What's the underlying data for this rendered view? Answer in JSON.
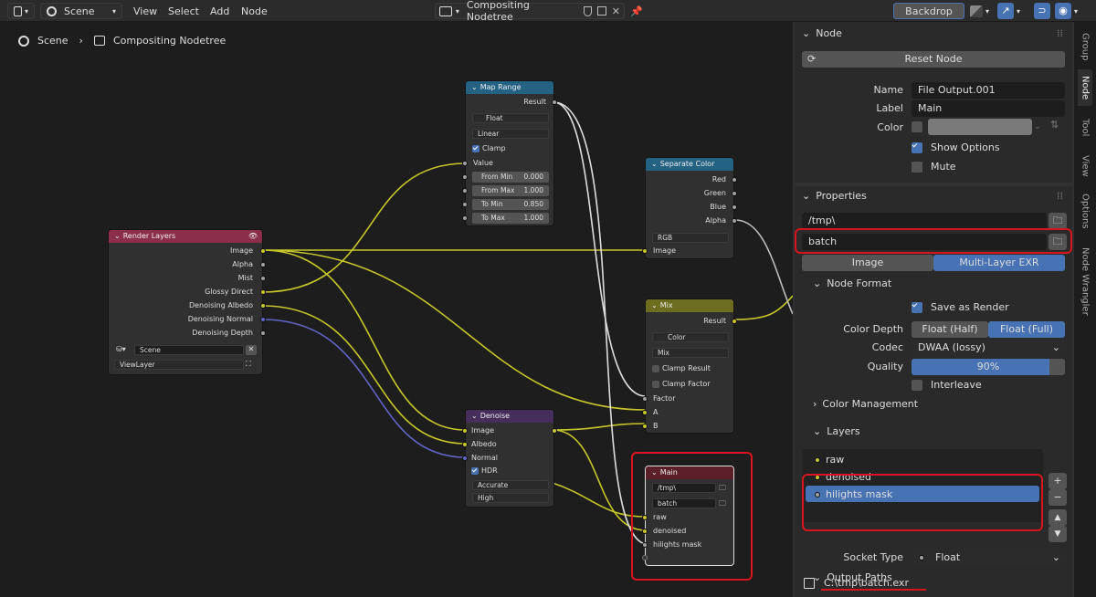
{
  "topbar": {
    "scene": "Scene",
    "menus": [
      "View",
      "Select",
      "Add",
      "Node"
    ],
    "nodetree": "Compositing Nodetree",
    "backdrop": "Backdrop"
  },
  "breadcrumb": {
    "scene": "Scene",
    "tree": "Compositing Nodetree"
  },
  "nodes": {
    "render_layers": {
      "title": "Render Layers",
      "outputs": [
        "Image",
        "Alpha",
        "Mist",
        "Glossy Direct",
        "Denoising Albedo",
        "Denoising Normal",
        "Denoising Depth"
      ],
      "scene": "Scene",
      "layer": "ViewLayer"
    },
    "map_range": {
      "title": "Map Range",
      "output": "Result",
      "type": "Float",
      "interp": "Linear",
      "clamp": "Clamp",
      "value": "Value",
      "fields": [
        {
          "label": "From Min",
          "value": "0.000"
        },
        {
          "label": "From Max",
          "value": "1.000"
        },
        {
          "label": "To Min",
          "value": "0.850"
        },
        {
          "label": "To Max",
          "value": "1.000"
        }
      ]
    },
    "separate_color": {
      "title": "Separate Color",
      "outputs": [
        "Red",
        "Green",
        "Blue",
        "Alpha"
      ],
      "mode": "RGB",
      "input": "Image"
    },
    "mix": {
      "title": "Mix",
      "output": "Result",
      "type": "Color",
      "blend": "Mix",
      "clamp_result": "Clamp Result",
      "clamp_factor": "Clamp Factor",
      "inputs": [
        "Factor",
        "A",
        "B"
      ]
    },
    "denoise": {
      "title": "Denoise",
      "inputs": [
        "Image",
        "Albedo",
        "Normal"
      ],
      "hdr": "HDR",
      "prefilter": "Accurate",
      "quality": "High"
    },
    "main": {
      "title": "Main",
      "path": "/tmp\\",
      "name": "batch",
      "inputs": [
        "raw",
        "denoised",
        "hilights mask"
      ]
    }
  },
  "sidebar": {
    "node_panel": {
      "header": "Node",
      "reset": "Reset Node",
      "name_label": "Name",
      "name_value": "File Output.001",
      "label_label": "Label",
      "label_value": "Main",
      "color_label": "Color",
      "show_options": "Show Options",
      "mute": "Mute"
    },
    "properties": {
      "header": "Properties",
      "path": "/tmp\\",
      "subpath": "batch",
      "tab_image": "Image",
      "tab_multilayer": "Multi-Layer EXR",
      "node_format": "Node Format",
      "save_as_render": "Save as Render",
      "color_depth_label": "Color Depth",
      "depth_half": "Float (Half)",
      "depth_full": "Float (Full)",
      "codec_label": "Codec",
      "codec_value": "DWAA (lossy)",
      "quality_label": "Quality",
      "quality_value": "90%",
      "quality_fraction": 0.9,
      "interleave": "Interleave",
      "color_management": "Color Management",
      "layers_header": "Layers",
      "layers": [
        "raw",
        "denoised",
        "hilights mask"
      ],
      "socket_type_label": "Socket Type",
      "socket_type_value": "Float",
      "output_paths": "Output Paths",
      "output_path_value": "C:\\tmp\\batch.exr"
    },
    "tabs": [
      "Group",
      "Node",
      "Tool",
      "View",
      "Options",
      "Node Wrangler"
    ]
  },
  "colors": {
    "accent": "#4772b3",
    "highlight": "#d8141d",
    "socket_yellow": "#c7c729",
    "socket_grey": "#a1a1a1",
    "socket_purple": "#6363c7",
    "header_render_layers": "#8b2e4a",
    "header_map_range": "#246283",
    "header_separate": "#246283",
    "header_mix": "#6d6d1f",
    "header_denoise": "#462e5c",
    "header_output": "#5c1f28"
  }
}
